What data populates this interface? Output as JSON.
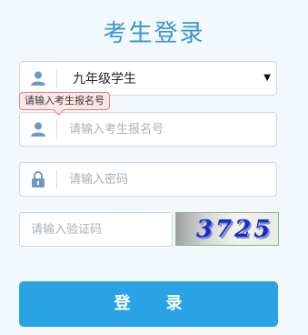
{
  "title": "考生登录",
  "grade_select": {
    "value": "九年级学生",
    "arrow": "▼"
  },
  "tooltip": "请输入考生报名号",
  "username": {
    "placeholder": "请输入考生报名号"
  },
  "password": {
    "placeholder": "请输入密码"
  },
  "captcha": {
    "placeholder": "请输入验证码",
    "image_text": "3725"
  },
  "login_button": "登　　录",
  "icons": {
    "user": "user-icon",
    "lock": "lock-icon"
  },
  "colors": {
    "accent": "#2aa3e4",
    "title": "#3596d2",
    "icon": "#6c9ac6"
  }
}
